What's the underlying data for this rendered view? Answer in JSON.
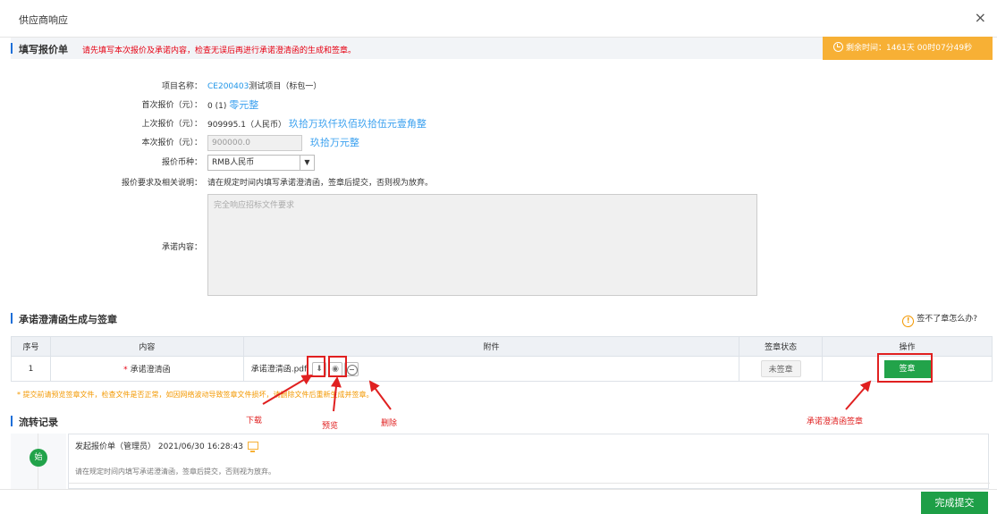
{
  "window": {
    "title": "供应商响应",
    "close_icon": "×"
  },
  "section1": {
    "title": "填写报价单",
    "warning": "请先填写本次报价及承诺内容，检查无误后再进行承诺澄清函的生成和签章。",
    "timer": "剩余时间：1461天 00时07分49秒"
  },
  "form": {
    "project_label": "项目名称：",
    "project_code": "CE200403",
    "project_name": "测试项目（标包一）",
    "first_quote_label": "首次报价（元）：",
    "first_quote_value": "0 (1)",
    "first_quote_words": "零元整",
    "last_quote_label": "上次报价（元）：",
    "last_quote_value": "909995.1（人民币）",
    "last_quote_words": "玖拾万玖仟玖佰玖拾伍元壹角整",
    "current_quote_label": "本次报价（元）：",
    "current_quote_value": "900000.0",
    "current_quote_words": "玖拾万元整",
    "currency_label": "报价币种：",
    "currency_value": "RMB人民币",
    "requirement_label": "报价要求及相关说明：",
    "requirement_text": "请在规定时间内填写承诺澄清函，签章后提交，否则视为放弃。",
    "commitment_label": "承诺内容：",
    "commitment_placeholder": "完全响应招标文件要求"
  },
  "section2": {
    "title": "承诺澄清函生成与签章",
    "help": "签不了章怎么办?",
    "table": {
      "headers": [
        "序号",
        "内容",
        "附件",
        "签章状态",
        "操作"
      ],
      "rows": [
        {
          "index": "1",
          "content": "承诺澄清函",
          "attachment": "承诺澄清函.pdf",
          "status": "未签章",
          "action": "签章"
        }
      ]
    },
    "note": "* 提交前请预览签章文件，检查文件是否正常，如因网络波动导致签章文件损坏，请删除文件后重新生成并签章。"
  },
  "annotations": {
    "download": "下载",
    "preview": "预览",
    "delete": "删除",
    "sign": "承诺澄清函签章"
  },
  "section3": {
    "title": "流转记录",
    "avatar_text": "始",
    "entry_head": "发起报价单（管理员） 2021/06/30 16:28:43",
    "entry_body": "请在规定时间内填写承诺澄清函，签章后提交，否则视为放弃。"
  },
  "footer": {
    "submit": "完成提交"
  },
  "colors": {
    "accent": "#1e6fd9",
    "warning": "#e60012",
    "timer": "#f7b035",
    "success": "#22a34a",
    "annotation": "#e02020"
  }
}
